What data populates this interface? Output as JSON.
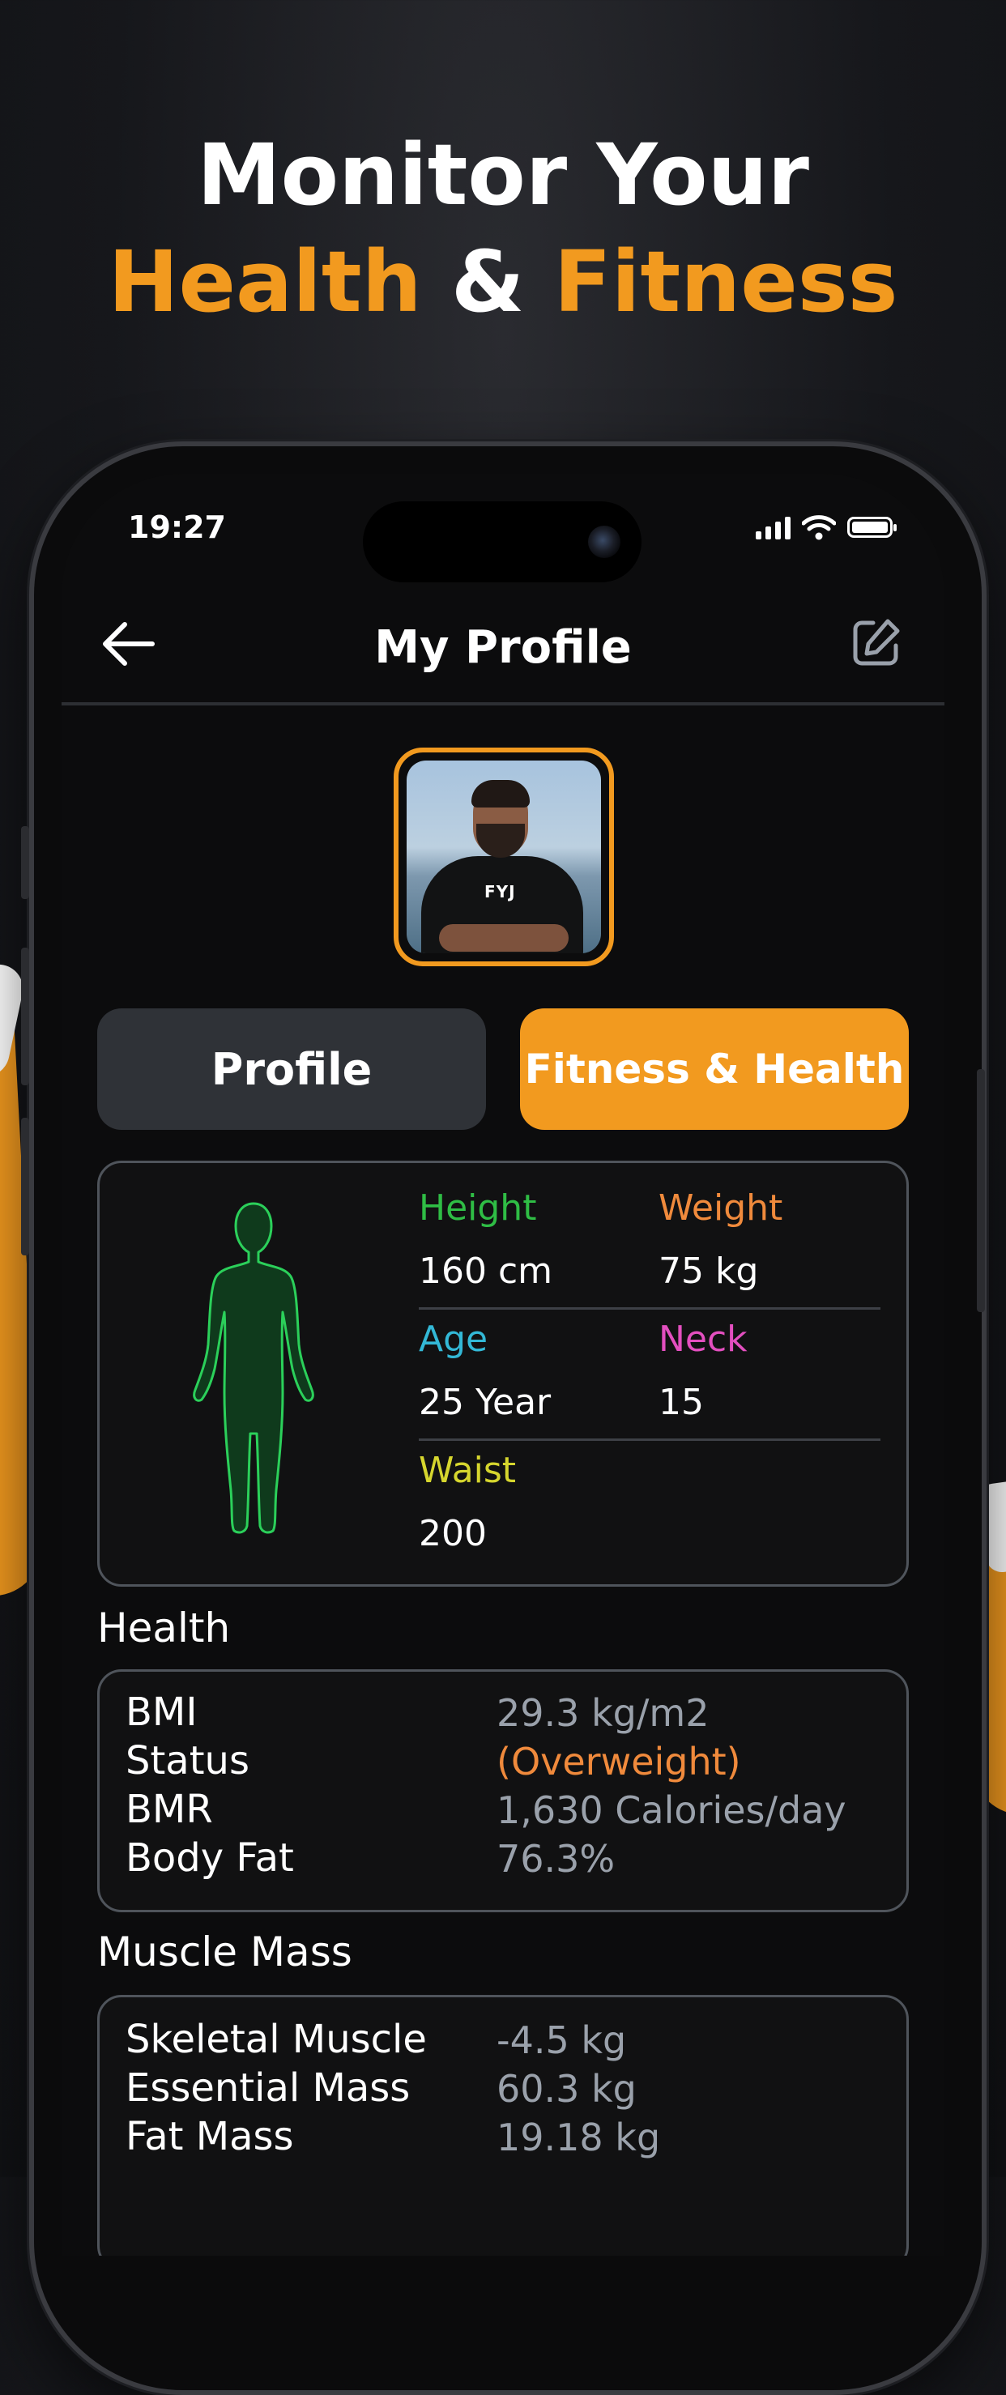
{
  "headline": {
    "line1": "Monitor Your",
    "word_health": "Health",
    "amp": "&",
    "word_fitness": "Fitness"
  },
  "colors": {
    "accent": "#f29a1f",
    "height": "#2fbd45",
    "weight": "#f08a3c",
    "age": "#33b8d6",
    "neck": "#e34fbf",
    "waist": "#d6d62e",
    "overweight": "#f08a3c"
  },
  "status_bar": {
    "time": "19:27"
  },
  "nav": {
    "title": "My Profile",
    "back_icon": "arrow-left-icon",
    "edit_icon": "edit-square-icon"
  },
  "tabs": {
    "profile": "Profile",
    "fitness": "Fitness & Health"
  },
  "stats": {
    "height_label": "Height",
    "height_value": "160 cm",
    "weight_label": "Weight",
    "weight_value": "75 kg",
    "age_label": "Age",
    "age_value": "25 Year",
    "neck_label": "Neck",
    "neck_value": "15",
    "waist_label": "Waist",
    "waist_value": "200"
  },
  "health": {
    "title": "Health",
    "rows": [
      {
        "label": "BMI",
        "value": "29.3 kg/m2"
      },
      {
        "label": "Status",
        "value": "(Overweight)"
      },
      {
        "label": "BMR",
        "value": "1,630 Calories/day"
      },
      {
        "label": "Body Fat",
        "value": "76.3%"
      }
    ]
  },
  "muscle": {
    "title": "Muscle Mass",
    "rows": [
      {
        "label": "Skeletal Muscle",
        "value": "-4.5 kg"
      },
      {
        "label": "Essential Mass",
        "value": "60.3 kg"
      },
      {
        "label": "Fat Mass",
        "value": "19.18 kg"
      }
    ]
  },
  "avatar": {
    "shirt_text": "FYJ"
  }
}
